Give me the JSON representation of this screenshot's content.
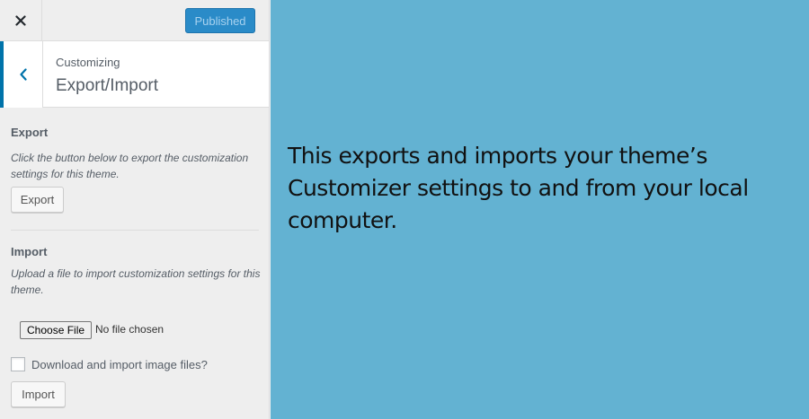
{
  "topbar": {
    "close_icon": "close-icon",
    "publish_label": "Published",
    "publish_color": "#2a8bc8"
  },
  "section_header": {
    "back_icon": "chevron-left-icon",
    "crumb": "Customizing",
    "title": "Export/Import"
  },
  "export": {
    "heading": "Export",
    "description": "Click the button below to export the customization settings for this theme.",
    "button_label": "Export"
  },
  "import": {
    "heading": "Import",
    "description": "Upload a file to import customization settings for this theme.",
    "choose_file_label": "Choose File",
    "no_file_text": "No file chosen",
    "checkbox_label": "Download and import image files?",
    "checkbox_checked": false,
    "button_label": "Import"
  },
  "preview": {
    "background": "#63b2d2",
    "text": "This exports and imports your theme’s Customizer settings to and from your local computer."
  }
}
